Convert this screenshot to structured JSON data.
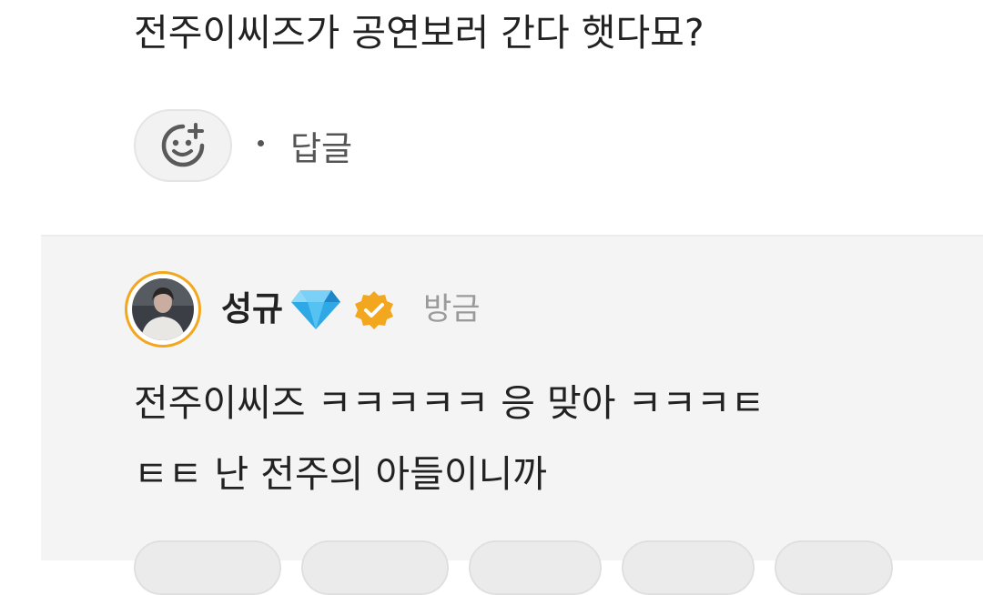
{
  "comment": {
    "text": "전주이씨즈가 공연보러 간다 햇다묘?",
    "reply_label": "답글",
    "react_icon": "add-emoji-icon"
  },
  "reply": {
    "author": "성규",
    "author_badge_icon": "diamond-icon",
    "verified_icon": "verified-check-icon",
    "time": "방금",
    "text_line1": "전주이씨즈 ㅋㅋㅋㅋㅋ 응 맞아 ㅋㅋㅋㅌ",
    "text_line2": "ㅌㅌ 난 전주의 아들이니까"
  },
  "colors": {
    "accent_orange": "#f2a71f",
    "background_reply": "#f4f4f4",
    "text_primary": "#222222",
    "text_muted": "#9a9a9a"
  }
}
